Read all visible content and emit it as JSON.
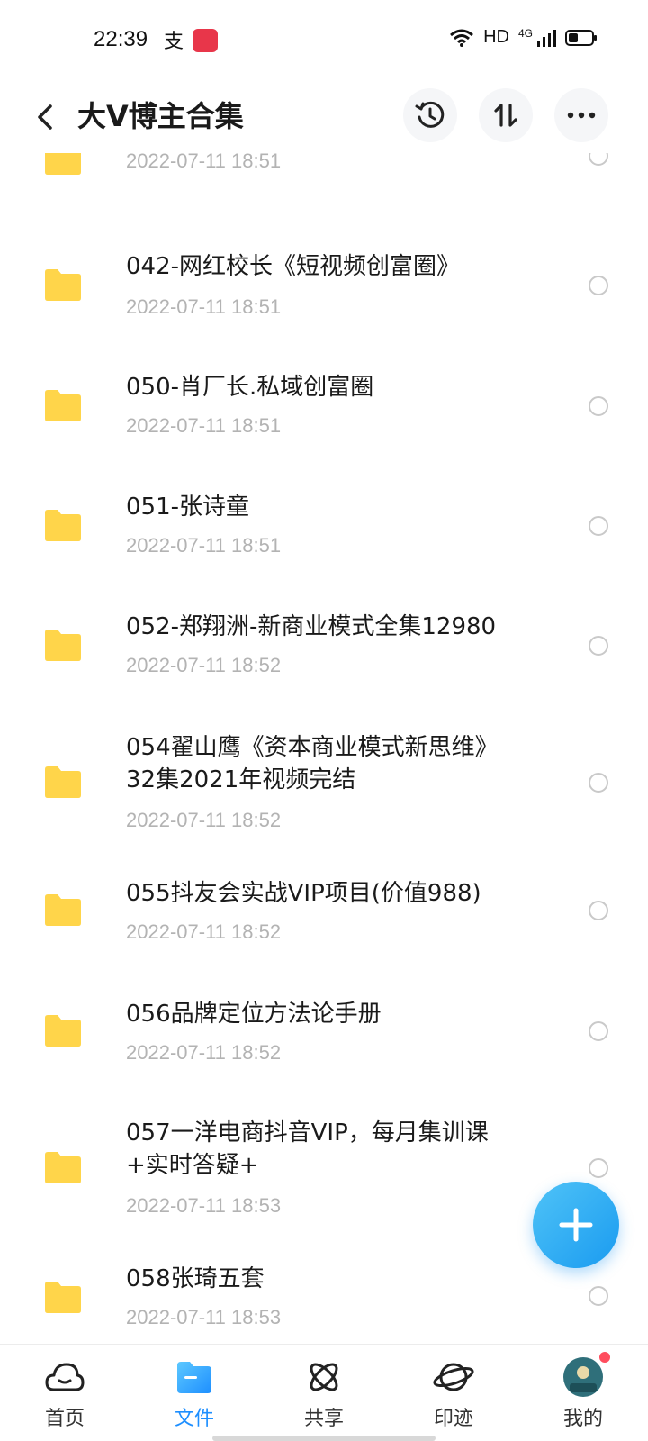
{
  "status_bar": {
    "time": "22:39",
    "network": "HD",
    "cellular": "4G"
  },
  "header": {
    "title": "大V博主合集",
    "icons": [
      "back-icon",
      "history-icon",
      "sort-icon",
      "more-icon"
    ]
  },
  "files": [
    {
      "name": "",
      "date": "2022-07-11  18:51"
    },
    {
      "name": "042-网红校长《短视频创富圈》",
      "date": "2022-07-11  18:51"
    },
    {
      "name": "050-肖厂长.私域创富圈",
      "date": "2022-07-11  18:51"
    },
    {
      "name": "051-张诗童",
      "date": "2022-07-11  18:51"
    },
    {
      "name": "052-郑翔洲-新商业模式全集12980",
      "date": "2022-07-11  18:52"
    },
    {
      "name": "054翟山鹰《资本商业模式新思维》32集2021年视频完结",
      "date": "2022-07-11  18:52"
    },
    {
      "name": "055抖友会实战VIP项目(价值988)",
      "date": "2022-07-11  18:52"
    },
    {
      "name": "056品牌定位方法论手册",
      "date": "2022-07-11  18:52"
    },
    {
      "name": "057一洋电商抖音VIP，每月集训课+实时答疑+",
      "date": "2022-07-11  18:53"
    },
    {
      "name": "058张琦五套",
      "date": "2022-07-11  18:53"
    }
  ],
  "colors": {
    "accent": "#1e8fff",
    "folder": "#ffd54a",
    "date_text": "#b3b3b3"
  },
  "bottom_nav": {
    "items": [
      {
        "label": "首页",
        "icon": "cloud-icon"
      },
      {
        "label": "文件",
        "icon": "folder-icon",
        "active": true
      },
      {
        "label": "共享",
        "icon": "atom-icon"
      },
      {
        "label": "印迹",
        "icon": "planet-icon"
      },
      {
        "label": "我的",
        "icon": "avatar-icon"
      }
    ]
  }
}
